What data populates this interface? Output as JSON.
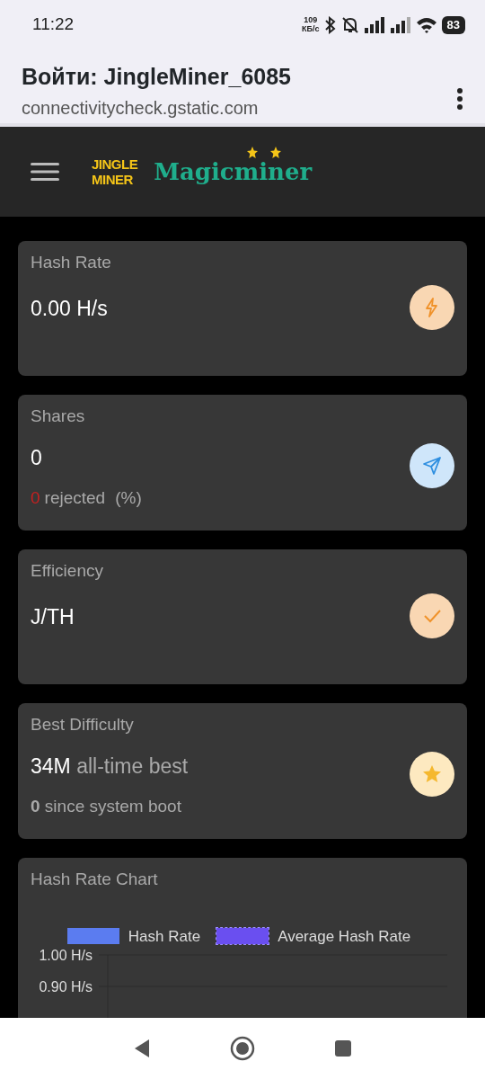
{
  "status_bar": {
    "time": "11:22",
    "speed": "109",
    "speed_unit": "КБ/с",
    "battery": "83"
  },
  "browser": {
    "title": "Войти: JingleMiner_6085",
    "url": "connectivitycheck.gstatic.com"
  },
  "logo": {
    "jingle_top": "JINGLE",
    "jingle_bottom": "MINER",
    "magic": "Magicminer"
  },
  "cards": [
    {
      "kind": "hashrate",
      "title": "Hash Rate",
      "value": "0.00 H/s",
      "color": "#f0922a"
    },
    {
      "kind": "shares",
      "title": "Shares",
      "value": "0",
      "rejected_count": "0",
      "rejected_label": "rejected",
      "percent": "(%)",
      "color": "#2f8fe0"
    },
    {
      "kind": "efficiency",
      "title": "Efficiency",
      "value": "J/TH",
      "color": "#f0922a"
    },
    {
      "kind": "best",
      "title": "Best Difficulty",
      "value": "34M",
      "value_suffix": "all-time best",
      "since_boot": "**0** since system boot",
      "color": "#f5b82e"
    }
  ],
  "chart": {
    "title": "Hash Rate Chart",
    "legend": [
      {
        "name": "Hash Rate",
        "color": "#5b7cf0"
      },
      {
        "name": "Average Hash Rate",
        "color": "#6a4ff0"
      }
    ],
    "y_labels": [
      "1.00 H/s",
      "0.90 H/s"
    ]
  }
}
